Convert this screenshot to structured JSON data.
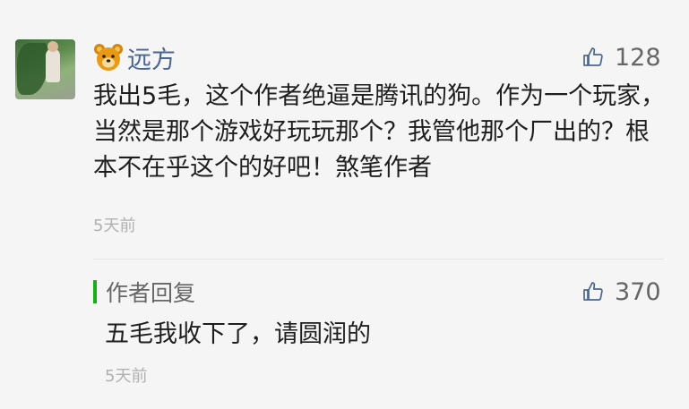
{
  "comment": {
    "author": "远方",
    "likes": "128",
    "text": "我出5毛，这个作者绝逼是腾讯的狗。作为一个玩家，当然是那个游戏好玩玩那个？我管他那个厂出的？根本不在乎这个的好吧！煞笔作者",
    "time": "5天前",
    "avatar_icon": "photo-avatar",
    "badge_icon": "bear-emoji-icon"
  },
  "reply": {
    "label": "作者回复",
    "likes": "370",
    "text": "五毛我收下了，请圆润的",
    "time": "5天前",
    "accent": "#1aad19"
  },
  "colors": {
    "background": "#f5f5f5",
    "author_name": "#4a6690",
    "meta": "#b0b0b0"
  }
}
